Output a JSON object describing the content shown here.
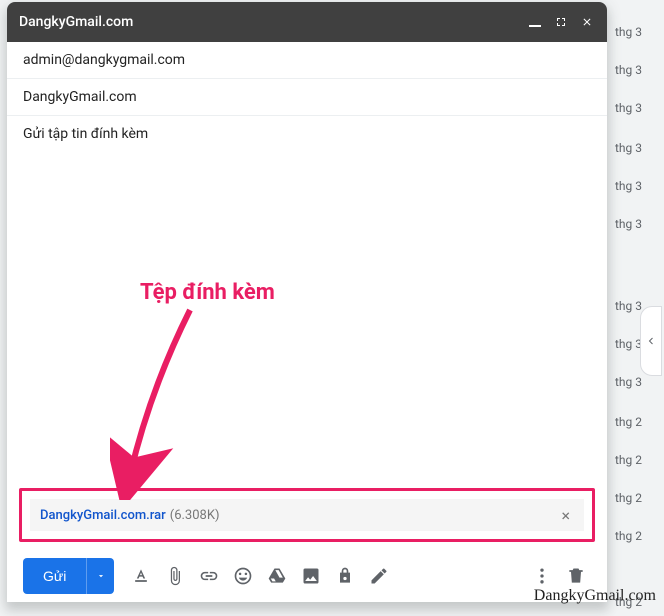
{
  "header": {
    "title": "DangkyGmail.com"
  },
  "fields": {
    "to": "admin@dangkygmail.com",
    "subject": "DangkyGmail.com",
    "body": "Gửi tập tin đính kèm"
  },
  "attachment": {
    "name": "DangkyGmail.com.rar",
    "size": "(6.308K)"
  },
  "toolbar": {
    "send": "Gửi"
  },
  "annotation": {
    "label": "Tệp đính kèm"
  },
  "watermark": "DangkyGmail.com",
  "bg_dates": [
    "thg 3",
    "thg 3",
    "thg 3",
    "thg 3",
    "thg 3",
    "thg 3",
    "thg 3",
    "thg 3",
    "thg 3",
    "thg 2",
    "thg 2",
    "thg 2",
    "thg 2",
    "thg 2"
  ]
}
